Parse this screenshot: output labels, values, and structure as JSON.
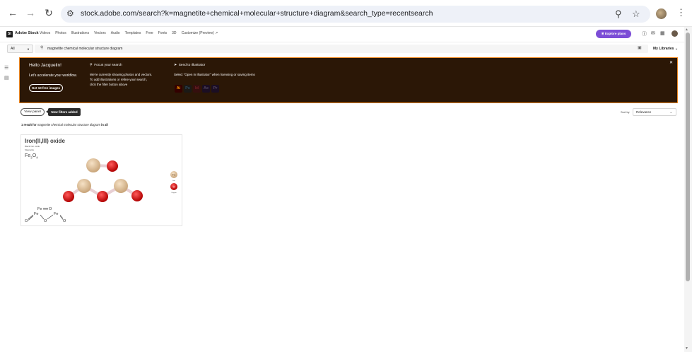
{
  "browser": {
    "url": "stock.adobe.com/search?k=magnetite+chemical+molecular+structure+diagram&search_type=recentsearch",
    "back_icon": "arrow-left-icon",
    "forward_icon": "arrow-right-icon",
    "reload_icon": "reload-icon"
  },
  "header": {
    "logo_mark": "St",
    "logo_text": "Adobe Stock",
    "nav": [
      "Videos",
      "Photos",
      "Illustrations",
      "Vectors",
      "Audio",
      "Templates",
      "Free",
      "Fonts",
      "3D",
      "Customize (Preview)"
    ],
    "explore_label": "Explore plans"
  },
  "search": {
    "scope": "All",
    "query": "magnetite chemical molecular structure diagram",
    "my_libraries": "My Libraries"
  },
  "banner": {
    "hello": "Hello Jacquelin!",
    "lets": "Let's accelerate your workflow.",
    "free_button": "Get 10 free images",
    "focus_title": "Focus your search",
    "focus_body_1": "We're currently showing photos and vectors.",
    "focus_body_2": "To add illustrations or refine your search,",
    "focus_body_3": "click the filter button above",
    "send_title": "Send to Illustrator",
    "send_body": "Select \"Open in Illustrator\" when licensing or saving items",
    "apps": [
      {
        "label": "Ai",
        "bg": "#330000",
        "fg": "#ff9a00"
      },
      {
        "label": "Ps",
        "bg": "#001e36",
        "fg": "#31a8ff"
      },
      {
        "label": "Id",
        "bg": "#49021f",
        "fg": "#ff3366"
      },
      {
        "label": "Ae",
        "bg": "#00005b",
        "fg": "#9999ff"
      },
      {
        "label": "Pr",
        "bg": "#00005b",
        "fg": "#9999ff"
      }
    ]
  },
  "filters": {
    "view_panel": "View panel",
    "new_filters": "New filters added",
    "sort_label": "Sort by",
    "sort_value": "Relevance"
  },
  "results": {
    "count_prefix": "1 result for",
    "count_query": "magnetite chemical molecular structure diagram",
    "count_suffix": "in all"
  },
  "card": {
    "title": "Iron(II,III) oxide",
    "sub1": "Black iron oxide",
    "sub2": "Magnetite",
    "formula_fe": "Fe",
    "formula_3": "3",
    "formula_o": "O",
    "formula_4": "4",
    "legend": [
      {
        "symbol": "Fe",
        "name": "Iron"
      },
      {
        "symbol": "O",
        "name": "Oxygen"
      }
    ],
    "struct_fe": "Fe",
    "struct_o": "O"
  },
  "colors": {
    "banner_bg": "#2b1706",
    "banner_border": "#f08a23",
    "explore": "#7c4dd6",
    "iron": "#e0c09a",
    "oxygen": "#d81818"
  }
}
